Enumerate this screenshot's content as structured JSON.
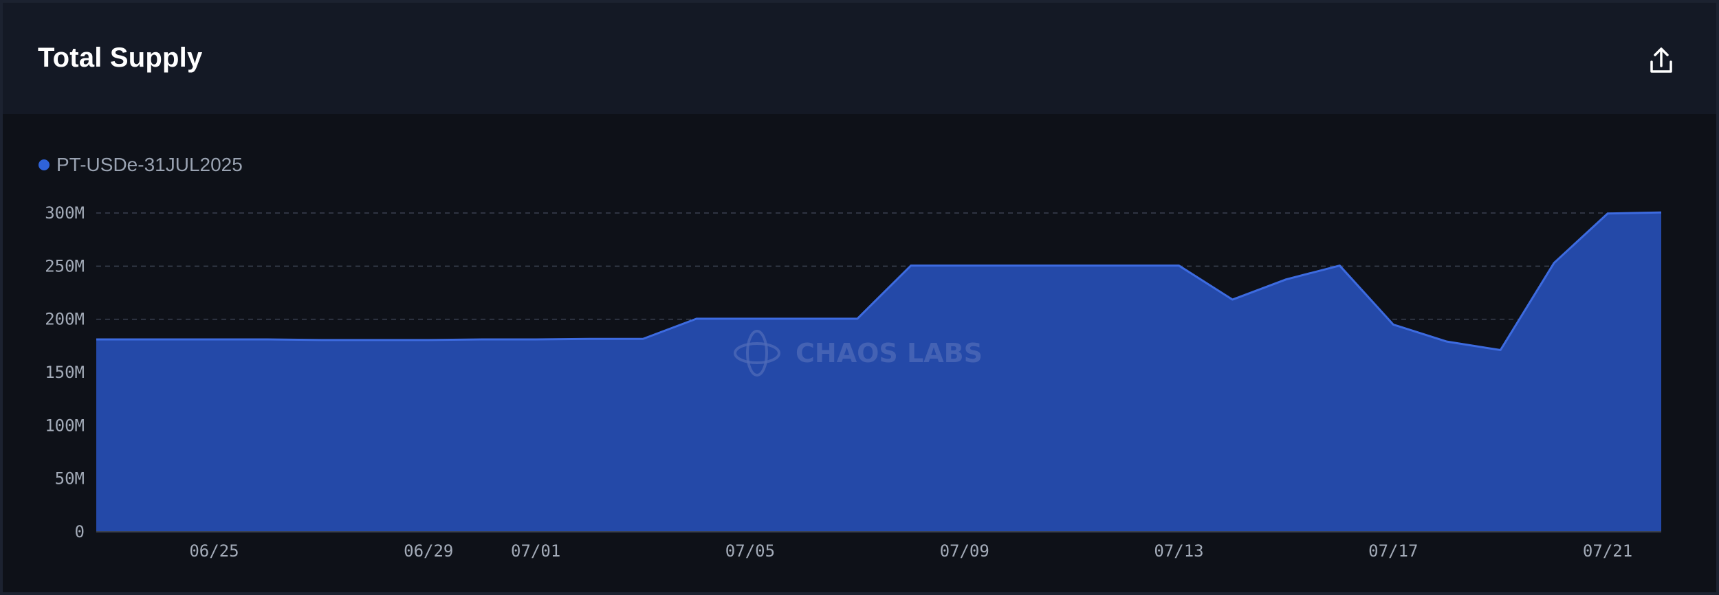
{
  "header": {
    "title": "Total Supply",
    "export_icon": "upload-icon"
  },
  "watermark": "CHAOS LABS",
  "colors": {
    "area_fill": "#2449a8",
    "area_line": "#3d6be0",
    "legend_dot": "#2f63d8",
    "grid": "#3a4150",
    "background": "#0e1118",
    "header_bg": "#141925"
  },
  "chart_data": {
    "type": "area",
    "grid": true,
    "legend_position": "top-left",
    "ylim": [
      0,
      300000000
    ],
    "y_ticks": [
      {
        "value": 0,
        "label": "0"
      },
      {
        "value": 50000000,
        "label": "50M"
      },
      {
        "value": 100000000,
        "label": "100M"
      },
      {
        "value": 150000000,
        "label": "150M"
      },
      {
        "value": 200000000,
        "label": "200M"
      },
      {
        "value": 250000000,
        "label": "250M"
      },
      {
        "value": 300000000,
        "label": "300M"
      }
    ],
    "x_ticks": [
      {
        "date": "06/25",
        "label": "06/25"
      },
      {
        "date": "06/29",
        "label": "06/29"
      },
      {
        "date": "07/01",
        "label": "07/01"
      },
      {
        "date": "07/05",
        "label": "07/05"
      },
      {
        "date": "07/09",
        "label": "07/09"
      },
      {
        "date": "07/13",
        "label": "07/13"
      },
      {
        "date": "07/17",
        "label": "07/17"
      },
      {
        "date": "07/21",
        "label": "07/21"
      }
    ],
    "series": [
      {
        "name": "PT-USDe-31JUL2025",
        "points": [
          {
            "date": "06/22.8",
            "value": 181000000
          },
          {
            "date": "06/23",
            "value": 181000000
          },
          {
            "date": "06/24",
            "value": 181000000
          },
          {
            "date": "06/25",
            "value": 181000000
          },
          {
            "date": "06/26",
            "value": 181000000
          },
          {
            "date": "06/27",
            "value": 180500000
          },
          {
            "date": "06/28",
            "value": 180500000
          },
          {
            "date": "06/29",
            "value": 180500000
          },
          {
            "date": "06/30",
            "value": 181000000
          },
          {
            "date": "07/01",
            "value": 181000000
          },
          {
            "date": "07/02",
            "value": 181500000
          },
          {
            "date": "07/03",
            "value": 181500000
          },
          {
            "date": "07/04",
            "value": 200500000
          },
          {
            "date": "07/05",
            "value": 200500000
          },
          {
            "date": "07/06",
            "value": 200500000
          },
          {
            "date": "07/07",
            "value": 200500000
          },
          {
            "date": "07/08",
            "value": 250500000
          },
          {
            "date": "07/09",
            "value": 250500000
          },
          {
            "date": "07/10",
            "value": 250500000
          },
          {
            "date": "07/11",
            "value": 250500000
          },
          {
            "date": "07/12",
            "value": 250500000
          },
          {
            "date": "07/13",
            "value": 250500000
          },
          {
            "date": "07/14",
            "value": 218500000
          },
          {
            "date": "07/15",
            "value": 237500000
          },
          {
            "date": "07/16",
            "value": 250500000
          },
          {
            "date": "07/17",
            "value": 195000000
          },
          {
            "date": "07/18",
            "value": 179000000
          },
          {
            "date": "07/19",
            "value": 171000000
          },
          {
            "date": "07/20",
            "value": 253000000
          },
          {
            "date": "07/21",
            "value": 299500000
          },
          {
            "date": "07/22",
            "value": 300500000
          }
        ]
      }
    ]
  }
}
